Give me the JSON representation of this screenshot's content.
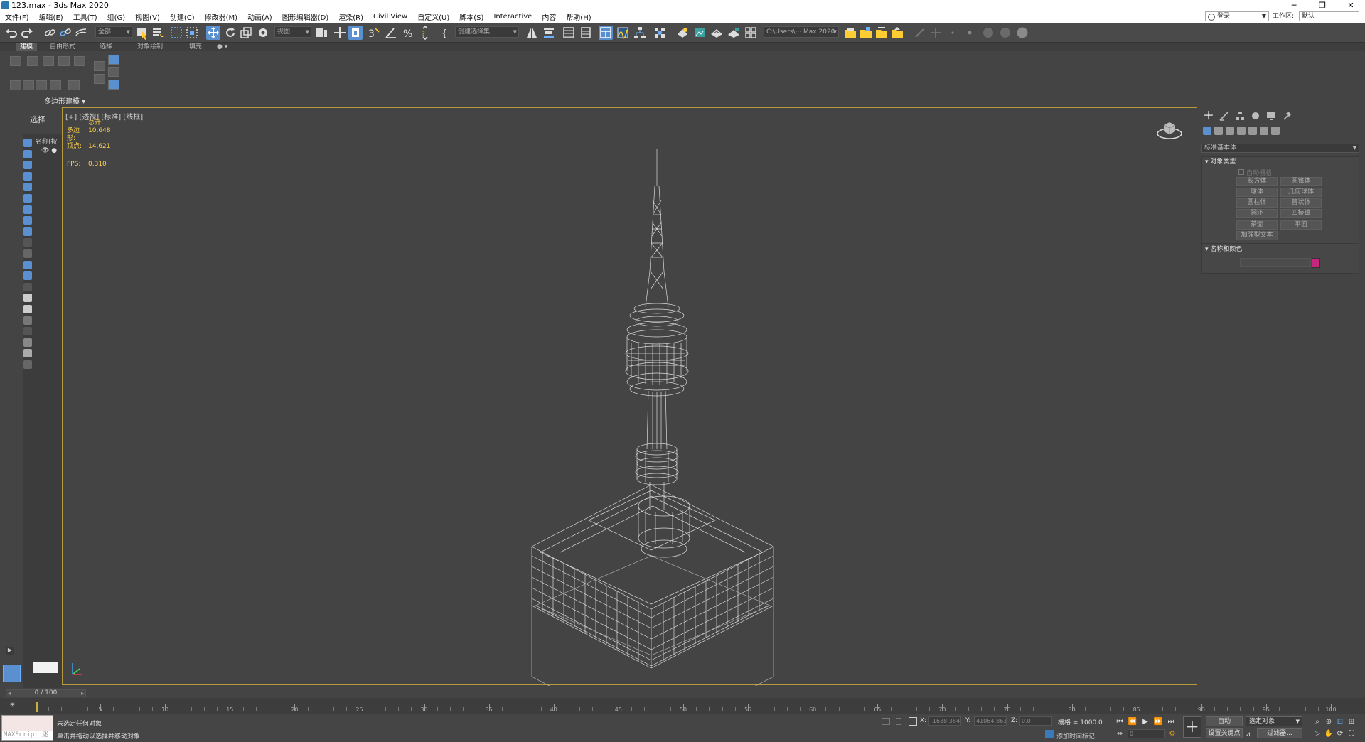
{
  "window": {
    "title": "123.max - 3ds Max 2020"
  },
  "menu": [
    "文件(F)",
    "编辑(E)",
    "工具(T)",
    "组(G)",
    "视图(V)",
    "创建(C)",
    "修改器(M)",
    "动画(A)",
    "图形编辑器(D)",
    "渲染(R)",
    "Civil View",
    "自定义(U)",
    "脚本(S)",
    "Interactive",
    "内容",
    "帮助(H)"
  ],
  "account": {
    "login": "登录",
    "workspace_label": "工作区:",
    "workspace_value": "默认"
  },
  "toolbar": {
    "filter_dropdown": "全部",
    "refcoord_dropdown": "视图",
    "named_selection": "创建选择集",
    "project_path": "C:\\Users\\··· Max 2020"
  },
  "ribbon": {
    "tabs": [
      "建模",
      "自由形式",
      "选择",
      "对象绘制",
      "填充"
    ],
    "active_tab": "建模",
    "panel_label": "多边形建模"
  },
  "scene_explorer": {
    "title": "选择",
    "column_header": "名称(按"
  },
  "viewport": {
    "label": "[+] [透视] [标准] [线框]",
    "stats_title": "总计",
    "polys_label": "多边形:",
    "polys_value": "10,648",
    "verts_label": "顶点:",
    "verts_value": "14,621",
    "fps_label": "FPS:",
    "fps_value": "0.310"
  },
  "command_panel": {
    "category": "标准基本体",
    "object_type_header": "对象类型",
    "autogrid": "自动栅格",
    "buttons": [
      "长方体",
      "圆锥体",
      "球体",
      "几何球体",
      "圆柱体",
      "管状体",
      "圆环",
      "四棱锥",
      "茶壶",
      "平面",
      "加强型文本"
    ],
    "name_color_header": "名称和颜色",
    "object_color": "#c8267c"
  },
  "timeline": {
    "slider_text": "0 / 100",
    "frame_start": 0,
    "frame_end": 100,
    "tick_labels": [
      "5",
      "10",
      "15",
      "20",
      "25",
      "30",
      "35",
      "40",
      "45",
      "50",
      "55",
      "60",
      "65",
      "70",
      "75",
      "80",
      "85",
      "90",
      "95",
      "100"
    ]
  },
  "status": {
    "maxscript_placeholder": "MAXScript 迷",
    "line1": "未选定任何对象",
    "line2": "单击并拖动以选择并移动对象",
    "x_label": "X:",
    "x_value": "-1638.384",
    "y_label": "Y:",
    "y_value": "41064.863",
    "z_label": "Z:",
    "z_value": "0.0",
    "grid": "栅格 = 1000.0",
    "add_time_tag": "添加时间标记",
    "auto_key": "自动",
    "set_key": "设置关键点",
    "selected_object": "选定对象",
    "key_filters": "过滤器...",
    "frame_value": "0"
  }
}
